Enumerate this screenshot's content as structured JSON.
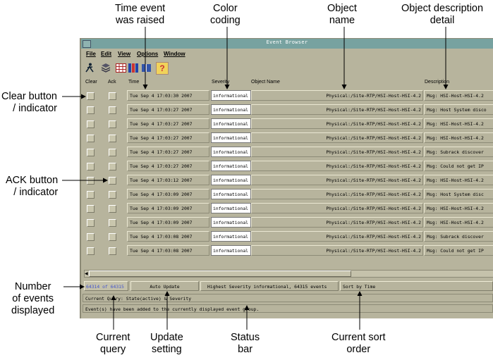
{
  "callouts": {
    "time_event": "Time event\nwas raised",
    "color_coding": "Color\ncoding",
    "object_name": "Object\nname",
    "object_desc": "Object description\ndetail",
    "clear_button": "Clear button\n/ indicator",
    "ack_button": "ACK button\n/ indicator",
    "num_events": "Number\nof events\ndisplayed",
    "current_query": "Current\nquery",
    "update_setting": "Update\nsetting",
    "status_bar": "Status\nbar",
    "sort_order": "Current sort\norder"
  },
  "figure_id": "202322",
  "window": {
    "title": "Event Browser",
    "menu": [
      "File",
      "Edit",
      "View",
      "Options",
      "Window"
    ],
    "toolbar_icons": [
      "person-running-icon",
      "stack-icon",
      "table-grid-icon",
      "columns-icon",
      "book-icon",
      "help-icon"
    ],
    "help_glyph": "?",
    "columns": {
      "clear": "Clear",
      "ack": "Ack",
      "time": "Time",
      "severity": "Severity",
      "object": "Object Name",
      "description": "Description"
    },
    "rows": [
      {
        "time": "Tue Sep  4 17:03:30 2007",
        "severity": "informational",
        "object": "Physical:/Site-RTP/HSI-Host-HSI-4.2",
        "description": "Msg: HSI-Host-HSI-4.2"
      },
      {
        "time": "Tue Sep  4 17:03:27 2007",
        "severity": "informational",
        "object": "Physical:/Site-RTP/HSI-Host-HSI-4.2",
        "description": "Msg: Host System disco"
      },
      {
        "time": "Tue Sep  4 17:03:27 2007",
        "severity": "informational",
        "object": "Physical:/Site-RTP/HSI-Host-HSI-4.2",
        "description": "Msg: HSI-Host-HSI-4.2"
      },
      {
        "time": "Tue Sep  4 17:03:27 2007",
        "severity": "informational",
        "object": "Physical:/Site-RTP/HSI-Host-HSI-4.2",
        "description": "Msg: HSI-Host-HSI-4.2"
      },
      {
        "time": "Tue Sep  4 17:03:27 2007",
        "severity": "informational",
        "object": "Physical:/Site-RTP/HSI-Host-HSI-4.2",
        "description": "Msg: Subrack discover"
      },
      {
        "time": "Tue Sep  4 17:03:27 2007",
        "severity": "informational",
        "object": "Physical:/Site-RTP/HSI-Host-HSI-4.2",
        "description": "Msg: Could not get IP"
      },
      {
        "time": "Tue Sep  4 17:03:12 2007",
        "severity": "informational",
        "object": "Physical:/Site-RTP/HSI-Host-HSI-4.2",
        "description": "Msg: HSI-Host-HSI-4.2"
      },
      {
        "time": "Tue Sep  4 17:03:09 2007",
        "severity": "informational",
        "object": "Physical:/Site-RTP/HSI-Host-HSI-4.2",
        "description": "Msg: Host System disc"
      },
      {
        "time": "Tue Sep  4 17:03:09 2007",
        "severity": "informational",
        "object": "Physical:/Site-RTP/HSI-Host-HSI-4.2",
        "description": "Msg: HSI-Host-HSI-4.2"
      },
      {
        "time": "Tue Sep  4 17:03:09 2007",
        "severity": "informational",
        "object": "Physical:/Site-RTP/HSI-Host-HSI-4.2",
        "description": "Msg: HSI-Host-HSI-4.2"
      },
      {
        "time": "Tue Sep  4 17:03:08 2007",
        "severity": "informational",
        "object": "Physical:/Site-RTP/HSI-Host-HSI-4.2",
        "description": "Msg: Subrack discover"
      },
      {
        "time": "Tue Sep  4 17:03:08 2007",
        "severity": "informational",
        "object": "Physical:/Site-RTP/HSI-Host-HSI-4.2",
        "description": "Msg: Could not get IP"
      }
    ],
    "status": {
      "count": "64314 of 64315",
      "update": "Auto Update",
      "severity_summary": "Highest Severity informational, 64315 events",
      "sort": "Sort by Time",
      "query": "Current Query: State(active) & Severity",
      "message": "Event(s) have been added to the currently displayed event group."
    },
    "colors": {
      "window_bg": "#b7b49d",
      "title_bar": "#77a2a0",
      "count_text": "#4455cc",
      "severity_bg": "#ffffff"
    }
  }
}
